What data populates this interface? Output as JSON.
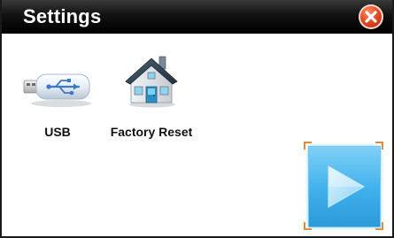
{
  "window": {
    "title": "Settings"
  },
  "titlebar": {
    "close_icon": "close-icon",
    "close_color": "#e04a1e"
  },
  "items": [
    {
      "label": "USB",
      "icon": "usb-drive-icon"
    },
    {
      "label": "Factory Reset",
      "icon": "house-icon"
    }
  ],
  "play_button": {
    "icon": "play-icon",
    "color": "#3fb0ec",
    "selection_color": "#e68a2e"
  }
}
